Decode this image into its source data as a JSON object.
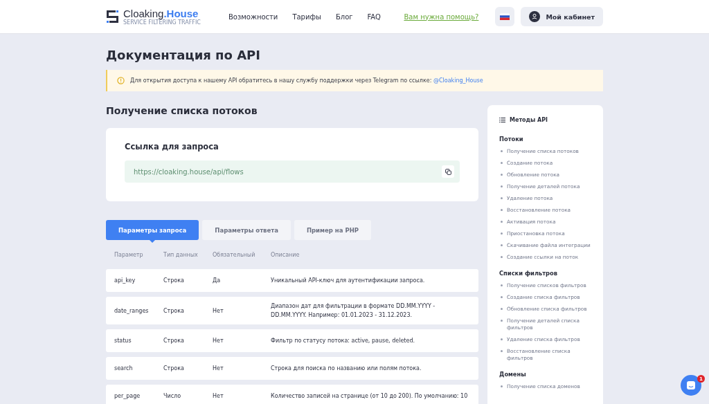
{
  "header": {
    "logo": {
      "text": "Cloaking",
      "accent": ".House",
      "tagline": "SERVICE FILTERING TRAFFIC"
    },
    "nav": [
      "Возможности",
      "Тарифы",
      "Блог",
      "FAQ"
    ],
    "help_link": "Вам нужна помощь?",
    "account_button": "Мой кабинет"
  },
  "page_title": "Документация по API",
  "alert": {
    "text": "Для открытия доступа к нашему API обратитесь в нашу службу поддержки через Telegram по ссылке:",
    "link": "@Cloaking_House"
  },
  "section_title": "Получение списка потоков",
  "request_card": {
    "title": "Ссылка для запроса",
    "url": "https://cloaking.house/api/flows"
  },
  "tabs": [
    {
      "label": "Параметры запроса",
      "selected": true
    },
    {
      "label": "Параметры ответа",
      "selected": false
    },
    {
      "label": "Пример на PHP",
      "selected": false
    }
  ],
  "table": {
    "columns": [
      "Параметр",
      "Тип данных",
      "Обязательный",
      "Описание"
    ],
    "rows": [
      [
        "api_key",
        "Строка",
        "Да",
        "Уникальный API-ключ для аутентификации запроса."
      ],
      [
        "date_ranges",
        "Строка",
        "Нет",
        "Диапазон дат для фильтрации в формате DD.MM.YYYY - DD.MM.YYYY. Например: 01.01.2023 - 31.12.2023."
      ],
      [
        "status",
        "Строка",
        "Нет",
        "Фильтр по статусу потока: active, pause, deleted."
      ],
      [
        "search",
        "Строка",
        "Нет",
        "Строка для поиска по названию или полям потока."
      ],
      [
        "per_page",
        "Число",
        "Нет",
        "Количество записей на странице (от 10 до 200). По умолчанию: 10"
      ]
    ]
  },
  "sidebar": {
    "title": "Методы API",
    "groups": [
      {
        "title": "Потоки",
        "items": [
          "Получение списка потоков",
          "Создание потока",
          "Обновление потока",
          "Получение деталей потока",
          "Удаление потока",
          "Восстановление потока",
          "Активация потока",
          "Приостановка потока",
          "Скачивание файла интеграции",
          "Создание ссылки на поток"
        ]
      },
      {
        "title": "Списки фильтров",
        "items": [
          "Получение списков фильтров",
          "Создание списка фильтров",
          "Обновление списка фильтров",
          "Получение деталей списка фильтров",
          "Удаление списка фильтров",
          "Восстановление списка фильтров"
        ]
      },
      {
        "title": "Домены",
        "items": [
          "Получение списка доменов"
        ]
      }
    ]
  },
  "chat": {
    "badge": "1"
  }
}
